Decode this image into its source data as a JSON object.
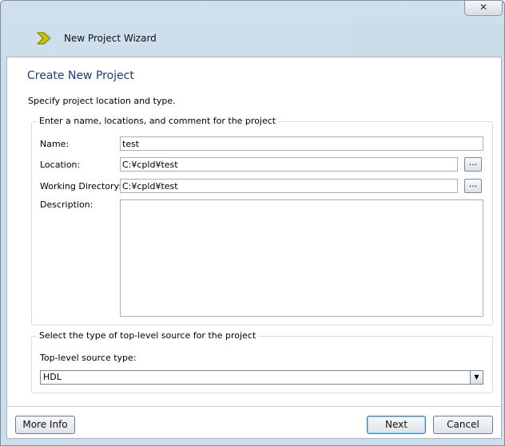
{
  "window": {
    "title": "New Project Wizard",
    "close_label": "✕"
  },
  "page": {
    "title": "Create New Project",
    "subtitle": "Specify project location and type."
  },
  "project_group": {
    "legend": "Enter a name, locations, and comment for the project",
    "name_label": "Name:",
    "name_value": "test",
    "location_label": "Location:",
    "location_value": "C:¥cpld¥test",
    "workdir_label": "Working Directory:",
    "workdir_value": "C:¥cpld¥test",
    "description_label": "Description:",
    "description_value": "",
    "browse_label": "..."
  },
  "source_group": {
    "legend": "Select the type of top-level source for the project",
    "type_label": "Top-level source type:",
    "type_value": "HDL"
  },
  "buttons": {
    "more_info": "More Info",
    "next": "Next",
    "cancel": "Cancel"
  },
  "icons": {
    "title_icon": "xilinx-chevron-icon",
    "dropdown": "chevron-down-icon"
  },
  "colors": {
    "title_blue": "#1f3f7a",
    "icon_yellow": "#c8c400"
  }
}
